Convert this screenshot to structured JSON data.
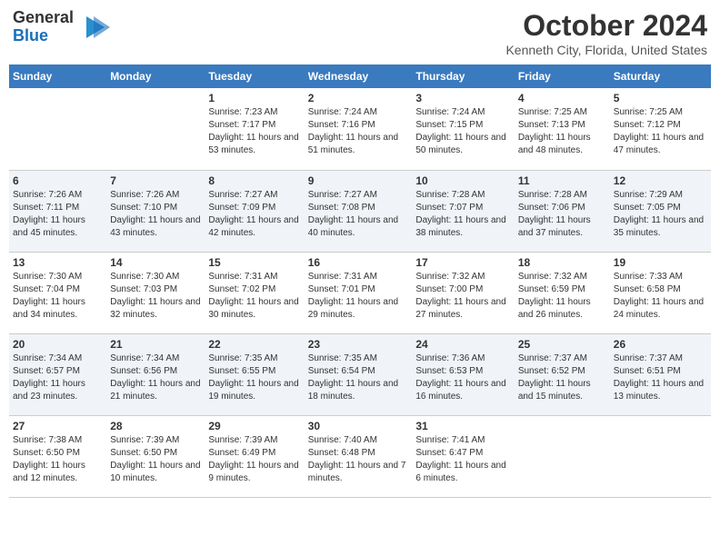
{
  "logo": {
    "line1": "General",
    "line2": "Blue",
    "icon": "▶"
  },
  "title": "October 2024",
  "subtitle": "Kenneth City, Florida, United States",
  "days_of_week": [
    "Sunday",
    "Monday",
    "Tuesday",
    "Wednesday",
    "Thursday",
    "Friday",
    "Saturday"
  ],
  "weeks": [
    [
      {
        "day": "",
        "info": ""
      },
      {
        "day": "",
        "info": ""
      },
      {
        "day": "1",
        "info": "Sunrise: 7:23 AM\nSunset: 7:17 PM\nDaylight: 11 hours and 53 minutes."
      },
      {
        "day": "2",
        "info": "Sunrise: 7:24 AM\nSunset: 7:16 PM\nDaylight: 11 hours and 51 minutes."
      },
      {
        "day": "3",
        "info": "Sunrise: 7:24 AM\nSunset: 7:15 PM\nDaylight: 11 hours and 50 minutes."
      },
      {
        "day": "4",
        "info": "Sunrise: 7:25 AM\nSunset: 7:13 PM\nDaylight: 11 hours and 48 minutes."
      },
      {
        "day": "5",
        "info": "Sunrise: 7:25 AM\nSunset: 7:12 PM\nDaylight: 11 hours and 47 minutes."
      }
    ],
    [
      {
        "day": "6",
        "info": "Sunrise: 7:26 AM\nSunset: 7:11 PM\nDaylight: 11 hours and 45 minutes."
      },
      {
        "day": "7",
        "info": "Sunrise: 7:26 AM\nSunset: 7:10 PM\nDaylight: 11 hours and 43 minutes."
      },
      {
        "day": "8",
        "info": "Sunrise: 7:27 AM\nSunset: 7:09 PM\nDaylight: 11 hours and 42 minutes."
      },
      {
        "day": "9",
        "info": "Sunrise: 7:27 AM\nSunset: 7:08 PM\nDaylight: 11 hours and 40 minutes."
      },
      {
        "day": "10",
        "info": "Sunrise: 7:28 AM\nSunset: 7:07 PM\nDaylight: 11 hours and 38 minutes."
      },
      {
        "day": "11",
        "info": "Sunrise: 7:28 AM\nSunset: 7:06 PM\nDaylight: 11 hours and 37 minutes."
      },
      {
        "day": "12",
        "info": "Sunrise: 7:29 AM\nSunset: 7:05 PM\nDaylight: 11 hours and 35 minutes."
      }
    ],
    [
      {
        "day": "13",
        "info": "Sunrise: 7:30 AM\nSunset: 7:04 PM\nDaylight: 11 hours and 34 minutes."
      },
      {
        "day": "14",
        "info": "Sunrise: 7:30 AM\nSunset: 7:03 PM\nDaylight: 11 hours and 32 minutes."
      },
      {
        "day": "15",
        "info": "Sunrise: 7:31 AM\nSunset: 7:02 PM\nDaylight: 11 hours and 30 minutes."
      },
      {
        "day": "16",
        "info": "Sunrise: 7:31 AM\nSunset: 7:01 PM\nDaylight: 11 hours and 29 minutes."
      },
      {
        "day": "17",
        "info": "Sunrise: 7:32 AM\nSunset: 7:00 PM\nDaylight: 11 hours and 27 minutes."
      },
      {
        "day": "18",
        "info": "Sunrise: 7:32 AM\nSunset: 6:59 PM\nDaylight: 11 hours and 26 minutes."
      },
      {
        "day": "19",
        "info": "Sunrise: 7:33 AM\nSunset: 6:58 PM\nDaylight: 11 hours and 24 minutes."
      }
    ],
    [
      {
        "day": "20",
        "info": "Sunrise: 7:34 AM\nSunset: 6:57 PM\nDaylight: 11 hours and 23 minutes."
      },
      {
        "day": "21",
        "info": "Sunrise: 7:34 AM\nSunset: 6:56 PM\nDaylight: 11 hours and 21 minutes."
      },
      {
        "day": "22",
        "info": "Sunrise: 7:35 AM\nSunset: 6:55 PM\nDaylight: 11 hours and 19 minutes."
      },
      {
        "day": "23",
        "info": "Sunrise: 7:35 AM\nSunset: 6:54 PM\nDaylight: 11 hours and 18 minutes."
      },
      {
        "day": "24",
        "info": "Sunrise: 7:36 AM\nSunset: 6:53 PM\nDaylight: 11 hours and 16 minutes."
      },
      {
        "day": "25",
        "info": "Sunrise: 7:37 AM\nSunset: 6:52 PM\nDaylight: 11 hours and 15 minutes."
      },
      {
        "day": "26",
        "info": "Sunrise: 7:37 AM\nSunset: 6:51 PM\nDaylight: 11 hours and 13 minutes."
      }
    ],
    [
      {
        "day": "27",
        "info": "Sunrise: 7:38 AM\nSunset: 6:50 PM\nDaylight: 11 hours and 12 minutes."
      },
      {
        "day": "28",
        "info": "Sunrise: 7:39 AM\nSunset: 6:50 PM\nDaylight: 11 hours and 10 minutes."
      },
      {
        "day": "29",
        "info": "Sunrise: 7:39 AM\nSunset: 6:49 PM\nDaylight: 11 hours and 9 minutes."
      },
      {
        "day": "30",
        "info": "Sunrise: 7:40 AM\nSunset: 6:48 PM\nDaylight: 11 hours and 7 minutes."
      },
      {
        "day": "31",
        "info": "Sunrise: 7:41 AM\nSunset: 6:47 PM\nDaylight: 11 hours and 6 minutes."
      },
      {
        "day": "",
        "info": ""
      },
      {
        "day": "",
        "info": ""
      }
    ]
  ]
}
